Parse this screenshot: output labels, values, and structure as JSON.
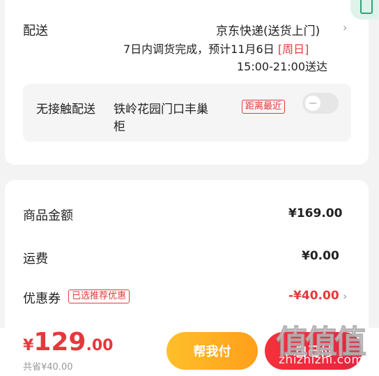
{
  "delivery": {
    "label": "配送",
    "method": "京东快递(送货上门)",
    "eta_prefix": "7日内调货完成，预计11月6日",
    "eta_day": "[周日]",
    "time_window": "15:00-21:00送达",
    "contactless": {
      "label": "无接触配送",
      "location_line1": "铁岭花园门口丰巢",
      "location_line2": "柜",
      "tag": "距离最近",
      "enabled": false
    }
  },
  "summary": {
    "goods_label": "商品金额",
    "goods_value": "¥169.00",
    "shipping_label": "运费",
    "shipping_value": "¥0.00",
    "coupon_label": "优惠券",
    "coupon_tag": "已选推荐优惠",
    "coupon_value": "-¥40.00"
  },
  "bottom": {
    "currency": "¥",
    "price_int": "129",
    "price_dec": ".00",
    "saved": "共省¥40.00",
    "help_button": "帮我付",
    "pay_button": "自己付"
  },
  "watermark": {
    "cn": "值值值",
    "en": "zhizhizhi.com"
  },
  "colors": {
    "accent_red": "#e4393c",
    "orange": "#ffa41f",
    "page_bg": "#f3f3f3"
  },
  "icons": {
    "chevron": "chevron-right-icon",
    "toggle": "toggle-switch"
  }
}
